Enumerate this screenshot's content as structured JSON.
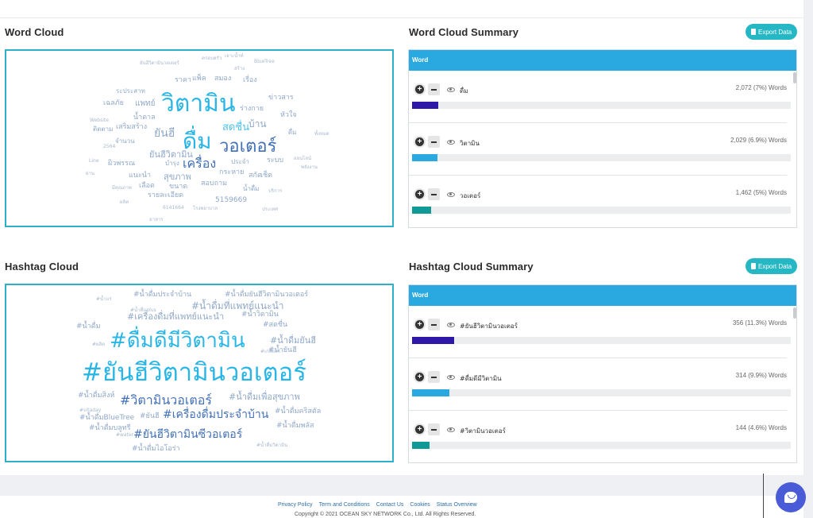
{
  "sections": {
    "word_cloud_title": "Word Cloud",
    "word_summary_title": "Word Cloud Summary",
    "hashtag_cloud_title": "Hashtag Cloud",
    "hashtag_summary_title": "Hashtag Cloud Summary",
    "export_label": "Export Data",
    "column_header": "Word"
  },
  "word_cloud": [
    {
      "text": "วิตามิน",
      "size": 30,
      "color": "#29b6e6"
    },
    {
      "text": "ดื่ม",
      "size": 28,
      "color": "#29b6e6"
    },
    {
      "text": "วอเตอร์",
      "size": 22,
      "color": "#4270b8"
    },
    {
      "text": "เครื่อง",
      "size": 16,
      "color": "#4270b8"
    },
    {
      "text": "ยันฮี",
      "size": 14,
      "color": "#8fa8c8"
    },
    {
      "text": "สดชื่น",
      "size": 13,
      "color": "#4ec3ea"
    },
    {
      "text": "บ้าน",
      "size": 12,
      "color": "#8fa8c8"
    },
    {
      "text": "ยันฮีวิตามิน",
      "size": 11,
      "color": "#8fa8c8"
    },
    {
      "text": "สุขภาพ",
      "size": 11,
      "color": "#8fa8c8"
    },
    {
      "text": "แพทย์",
      "size": 10,
      "color": "#8fa8c8"
    },
    {
      "text": "เสริมสร้าง",
      "size": 9,
      "color": "#8fa8c8"
    },
    {
      "text": "น้ำดาล",
      "size": 9,
      "color": "#8fa8c8"
    },
    {
      "text": "เฉลภัย",
      "size": 9,
      "color": "#8fa8c8"
    },
    {
      "text": "ผิวพรรณ",
      "size": 9,
      "color": "#8fa8c8"
    },
    {
      "text": "แนะนำ",
      "size": 9,
      "color": "#8fa8c8"
    },
    {
      "text": "เลือด",
      "size": 9,
      "color": "#8fa8c8"
    },
    {
      "text": "รายละเอียด",
      "size": 9,
      "color": "#8fa8c8"
    },
    {
      "text": "5159669",
      "size": 9,
      "color": "#8fa8c8"
    },
    {
      "text": "ขนาด",
      "size": 9,
      "color": "#8fa8c8"
    },
    {
      "text": "สอบถาม",
      "size": 9,
      "color": "#8fa8c8"
    },
    {
      "text": "กระหาย",
      "size": 9,
      "color": "#8fa8c8"
    },
    {
      "text": "สกัด",
      "size": 9,
      "color": "#8fa8c8"
    },
    {
      "text": "เช็ด",
      "size": 9,
      "color": "#8fa8c8"
    },
    {
      "text": "ระบบ",
      "size": 9,
      "color": "#8fa8c8"
    },
    {
      "text": "ข่าวสาร",
      "size": 9,
      "color": "#8fa8c8"
    },
    {
      "text": "หัวใจ",
      "size": 9,
      "color": "#8fa8c8"
    },
    {
      "text": "ร่างกาย",
      "size": 9,
      "color": "#8fa8c8"
    },
    {
      "text": "เรื่อง",
      "size": 9,
      "color": "#8fa8c8"
    },
    {
      "text": "ราคา",
      "size": 9,
      "color": "#8fa8c8"
    },
    {
      "text": "แพ็ค",
      "size": 9,
      "color": "#8fa8c8"
    },
    {
      "text": "สมอง",
      "size": 9,
      "color": "#8fa8c8"
    },
    {
      "text": "ระประสาท",
      "size": 8,
      "color": "#8fa8c8"
    },
    {
      "text": "ติดตาม",
      "size": 8,
      "color": "#8fa8c8"
    },
    {
      "text": "จำนวน",
      "size": 8,
      "color": "#8fa8c8"
    },
    {
      "text": "บำรุง",
      "size": 8,
      "color": "#8fa8c8"
    },
    {
      "text": "ประจำ",
      "size": 8,
      "color": "#8fa8c8"
    },
    {
      "text": "น้ำดื่ม",
      "size": 8,
      "color": "#8fa8c8"
    },
    {
      "text": "ดื่ม",
      "size": 8,
      "color": "#8fa8c8"
    },
    {
      "text": "Website",
      "size": 6,
      "color": "#a8b8cc"
    },
    {
      "text": "2564",
      "size": 6,
      "color": "#a8b8cc"
    },
    {
      "text": "Line",
      "size": 6,
      "color": "#a8b8cc"
    },
    {
      "text": "BlueTree",
      "size": 6,
      "color": "#a8b8cc"
    },
    {
      "text": "6141664",
      "size": 6,
      "color": "#a8b8cc"
    },
    {
      "text": "ยันฮีวิตามินวอเตอร์",
      "size": 6,
      "color": "#a8b8cc"
    },
    {
      "text": "ครอบครัว",
      "size": 6,
      "color": "#a8b8cc"
    },
    {
      "text": "เจาะน้ำท์",
      "size": 6,
      "color": "#a8b8cc"
    },
    {
      "text": "สร้าง",
      "size": 6,
      "color": "#a8b8cc"
    },
    {
      "text": "ผลิต",
      "size": 6,
      "color": "#a8b8cc"
    },
    {
      "text": "ประเทศ",
      "size": 6,
      "color": "#a8b8cc"
    },
    {
      "text": "ออนไลน์",
      "size": 6,
      "color": "#a8b8cc"
    },
    {
      "text": "อาหาร",
      "size": 6,
      "color": "#a8b8cc"
    },
    {
      "text": "โรงพยาบาล",
      "size": 6,
      "color": "#a8b8cc"
    },
    {
      "text": "ทั้งหมด",
      "size": 6,
      "color": "#a8b8cc"
    },
    {
      "text": "ผ่าน",
      "size": 6,
      "color": "#a8b8cc"
    },
    {
      "text": "บริการ",
      "size": 6,
      "color": "#a8b8cc"
    },
    {
      "text": "พลังงาน",
      "size": 6,
      "color": "#a8b8cc"
    },
    {
      "text": "มีคุณภาพ",
      "size": 6,
      "color": "#a8b8cc"
    }
  ],
  "word_summary": [
    {
      "word": "ดื่ม",
      "count": "2,072 (7%) Words",
      "share": 0.07,
      "color": "#2f18a8"
    },
    {
      "word": "วิตามิน",
      "count": "2,029 (6.9%) Words",
      "share": 0.069,
      "color": "#2aa9e0"
    },
    {
      "word": "วอเตอร์",
      "count": "1,462 (5%) Words",
      "share": 0.05,
      "color": "#0f9a96"
    }
  ],
  "hashtag_cloud": [
    {
      "text": "#ยันฮีวิตามินวอเตอร์",
      "size": 31,
      "color": "#29b6e6"
    },
    {
      "text": "#ดื่มดีมีวิตามิน",
      "size": 26,
      "color": "#29b6e6"
    },
    {
      "text": "#วิตามินวอเตอร์",
      "size": 16,
      "color": "#4270b8"
    },
    {
      "text": "#เครื่องดื่มประจำบ้าน",
      "size": 14,
      "color": "#4270b8"
    },
    {
      "text": "#ยันฮีวิตามินซีวอเตอร์",
      "size": 14,
      "color": "#4270b8"
    },
    {
      "text": "#น้ำดื่มที่แพทย์แนะนำ",
      "size": 12,
      "color": "#8fa8c8"
    },
    {
      "text": "#เครื่องดื่มที่แพทย์แนะนำ",
      "size": 11,
      "color": "#8fa8c8"
    },
    {
      "text": "#น้ำดื่มเพื่อสุขภาพ",
      "size": 11,
      "color": "#8fa8c8"
    },
    {
      "text": "#น้ำดื่มยันฮี",
      "size": 11,
      "color": "#8fa8c8"
    },
    {
      "text": "#น้ำดื่มประจำบ้าน",
      "size": 9,
      "color": "#8fa8c8"
    },
    {
      "text": "#น้ำดื่มยันฮีวิตามินวอเตอร์",
      "size": 9,
      "color": "#8fa8c8"
    },
    {
      "text": "#น้ำวิตามิน",
      "size": 9,
      "color": "#8fa8c8"
    },
    {
      "text": "#สดชื่น",
      "size": 9,
      "color": "#8fa8c8"
    },
    {
      "text": "#น้ำยันฮี",
      "size": 9,
      "color": "#8fa8c8"
    },
    {
      "text": "#น้ำดื่ม",
      "size": 9,
      "color": "#8fa8c8"
    },
    {
      "text": "#น้ำดื่มสิงห์",
      "size": 9,
      "color": "#8fa8c8"
    },
    {
      "text": "#น้ำดื่มคริสตัล",
      "size": 9,
      "color": "#8fa8c8"
    },
    {
      "text": "#น้ำดื่มBlueTree",
      "size": 9,
      "color": "#8fa8c8"
    },
    {
      "text": "#ยันฮี",
      "size": 9,
      "color": "#8fa8c8"
    },
    {
      "text": "#น้ำดื่มบลูทรี",
      "size": 9,
      "color": "#8fa8c8"
    },
    {
      "text": "#น้ำดื่มพลัส",
      "size": 9,
      "color": "#8fa8c8"
    },
    {
      "text": "#น้ำดื่มไอโอร่า",
      "size": 9,
      "color": "#8fa8c8"
    },
    {
      "text": "#น้ำดื่มวิตามิน",
      "size": 6,
      "color": "#a8b8cc"
    },
    {
      "text": "#น้ำแร่",
      "size": 6,
      "color": "#a8b8cc"
    },
    {
      "text": "#water",
      "size": 6,
      "color": "#a8b8cc"
    },
    {
      "text": "#vitaday",
      "size": 6,
      "color": "#a8b8cc"
    },
    {
      "text": "#น้ำดื่มplus",
      "size": 6,
      "color": "#a8b8cc"
    },
    {
      "text": "#ผลิต",
      "size": 6,
      "color": "#a8b8cc"
    },
    {
      "text": "#เกลือแร่",
      "size": 6,
      "color": "#a8b8cc"
    }
  ],
  "hashtag_summary": [
    {
      "word": "#ยันฮีวิตามินวอเตอร์",
      "count": "356 (11.3%) Words",
      "share": 0.113,
      "color": "#2f18a8"
    },
    {
      "word": "#ดื่มดีมีวิตามิน",
      "count": "314 (9.9%) Words",
      "share": 0.099,
      "color": "#2aa9e0"
    },
    {
      "word": "#วิตามินวอเตอร์",
      "count": "144 (4.6%) Words",
      "share": 0.046,
      "color": "#0f9a96"
    }
  ],
  "footer": {
    "links": [
      "Privacy Policy",
      "Term and Conditions",
      "Contact Us",
      "Cookies",
      "Status Overview"
    ],
    "copyright": "Copyright © 2021 OCEAN SKY NETWORK Co., Ltd. All Rights Reserved."
  }
}
